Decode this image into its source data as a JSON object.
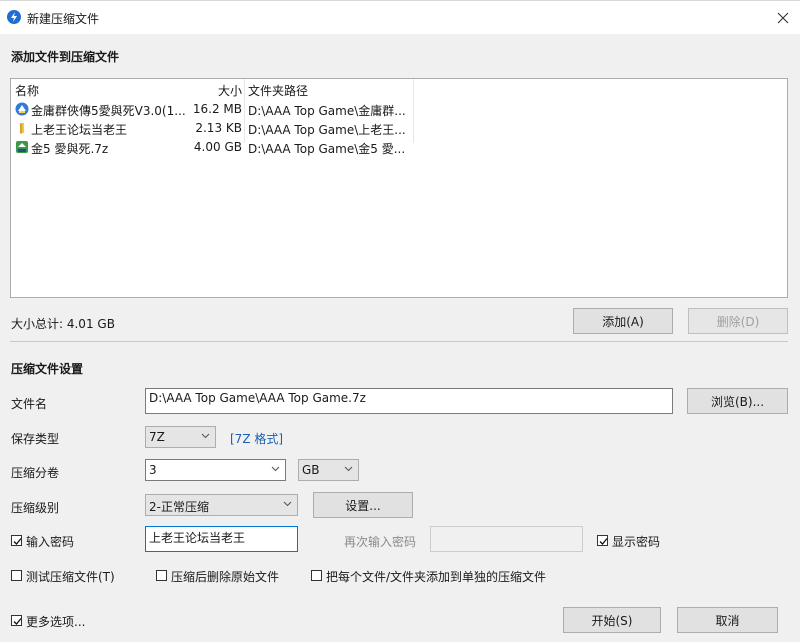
{
  "window": {
    "title": "新建压缩文件",
    "close_icon": "close-icon"
  },
  "add_section": {
    "heading": "添加文件到压缩文件"
  },
  "file_list": {
    "columns": [
      "名称",
      "大小",
      "文件夹路径"
    ],
    "rows": [
      {
        "icon": "app-exe-icon",
        "name": "金庸群俠傳5愛與死V3.0(1...",
        "size": "16.2 MB",
        "path": "D:\\AAA Top Game\\金庸群..."
      },
      {
        "icon": "folder-icon",
        "name": "上老王论坛当老王",
        "size": "2.13 KB",
        "path": "D:\\AAA Top Game\\上老王..."
      },
      {
        "icon": "archive-7z-icon",
        "name": "金5 愛與死.7z",
        "size": "4.00 GB",
        "path": "D:\\AAA Top Game\\金5 愛..."
      }
    ]
  },
  "total_size": "大小总计: 4.01 GB",
  "buttons": {
    "add": "添加(A)",
    "delete": "删除(D)",
    "browse": "浏览(B)...",
    "settings": "设置...",
    "start": "开始(S)",
    "cancel": "取消"
  },
  "settings_section": {
    "heading": "压缩文件设置"
  },
  "fields": {
    "filename_label": "文件名",
    "filename_value": "D:\\AAA Top Game\\AAA Top Game.7z",
    "save_type_label": "保存类型",
    "save_type_value": "7Z",
    "format_link": "[7Z 格式]",
    "split_label": "压缩分卷",
    "split_value": "3",
    "split_unit": "GB",
    "level_label": "压缩级别",
    "level_value": "2-正常压缩",
    "password_label": "输入密码",
    "password_value": "上老王论坛当老王",
    "confirm_label": "再次输入密码",
    "confirm_value": "",
    "show_password_label": "显示密码"
  },
  "options": {
    "test": "测试压缩文件(T)",
    "delete_after": "压缩后删除原始文件",
    "separate": "把每个文件/文件夹添加到单独的压缩文件",
    "more": "更多选项..."
  },
  "checkbox_states": {
    "password": true,
    "show_password": true,
    "test": false,
    "delete_after": false,
    "separate": false,
    "more": true
  },
  "colors": {
    "accent": "#0078d7",
    "link": "#1a5fb4",
    "app_icon": "#1e6fd1"
  }
}
